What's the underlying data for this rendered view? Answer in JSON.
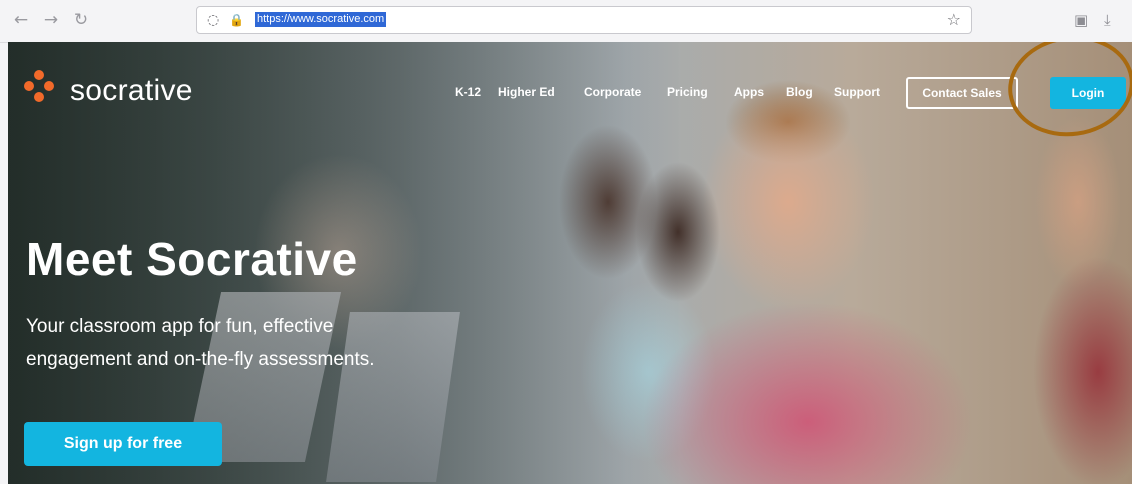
{
  "browser": {
    "back_icon": "←",
    "forward_icon": "→",
    "reload_icon": "↻",
    "shield_icon": "◌",
    "lock_icon": "🔒",
    "url": "https://www.socrative.com",
    "bookmark_icon": "☆",
    "pocket_icon": "▣",
    "download_icon": "⤓"
  },
  "site": {
    "logo_text": "socrative",
    "nav": [
      "K-12",
      "Higher Ed",
      "Corporate",
      "Pricing",
      "Apps",
      "Blog",
      "Support"
    ],
    "contact_label": "Contact Sales",
    "login_label": "Login"
  },
  "hero": {
    "title": "Meet Socrative",
    "subtitle_line1": "Your classroom app for fun, effective",
    "subtitle_line2": "engagement and on-the-fly assessments.",
    "cta_label": "Sign up for free"
  },
  "colors": {
    "accent": "#13b5e0",
    "logo_orange": "#f26a2a",
    "annotation": "#a86a10"
  }
}
